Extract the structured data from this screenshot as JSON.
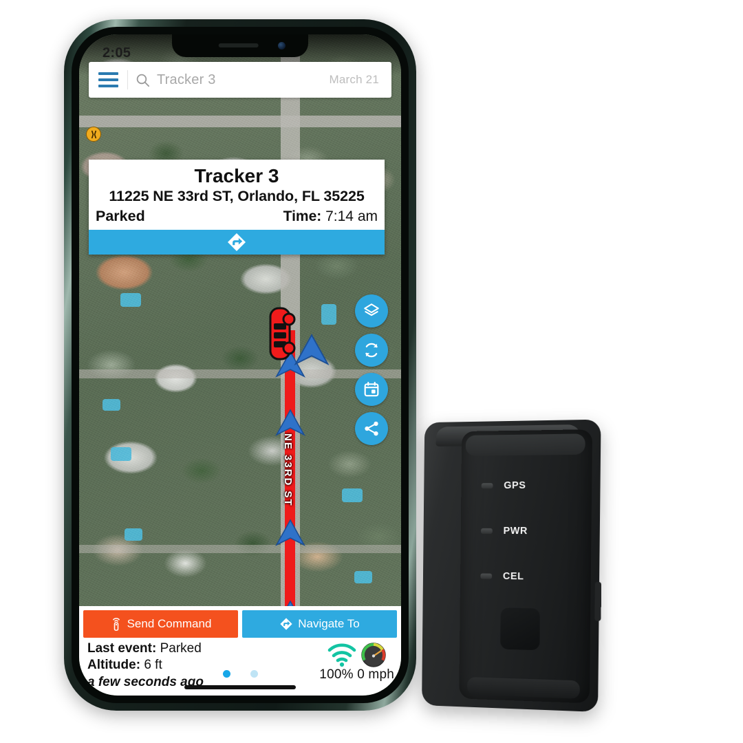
{
  "phone": {
    "status_time": "2:05",
    "searchbar": {
      "menu_icon": "hamburger-icon",
      "search_icon": "search-icon",
      "query_value": "Tracker 3",
      "query_placeholder": "Tracker 3",
      "date_label": "March 21"
    },
    "info_card": {
      "title": "Tracker 3",
      "address": "11225 NE 33rd ST, Orlando, FL 35225",
      "status": "Parked",
      "time_label": "Time:",
      "time_value": "7:14 am",
      "action_icon": "navigate-diamond-icon"
    },
    "map": {
      "street_label": "NE 33RD ST",
      "vehicle_icon": "red-car-icon",
      "heading_icon": "blue-heading-arrow-icon",
      "route_color": "#ef1b1b",
      "poi_icon": "poi-marker-icon",
      "fabs": [
        {
          "name": "layers-button",
          "icon": "layers-icon"
        },
        {
          "name": "refresh-button",
          "icon": "refresh-icon"
        },
        {
          "name": "calendar-button",
          "icon": "calendar-icon"
        },
        {
          "name": "share-button",
          "icon": "share-icon"
        }
      ]
    },
    "bottom_panel": {
      "send_command_label": "Send Command",
      "send_command_icon": "remote-signal-icon",
      "send_command_color": "#f4511e",
      "navigate_label": "Navigate To",
      "navigate_icon": "navigate-diamond-icon",
      "navigate_color": "#2eaae0",
      "last_event_label": "Last event:",
      "last_event_value": "Parked",
      "altitude_label": "Altitude:",
      "altitude_value": "6 ft",
      "relative_time": "a few seconds ago",
      "signal_icon": "wifi-signal-icon",
      "signal_value": "100%",
      "speed_icon": "speedometer-icon",
      "speed_value": "0 mph",
      "pagination": {
        "total": 2,
        "active_index": 0
      }
    }
  },
  "device": {
    "leds": [
      {
        "label": "GPS"
      },
      {
        "label": "PWR"
      },
      {
        "label": "CEL"
      }
    ]
  },
  "colors": {
    "accent_blue": "#2eaae0",
    "accent_orange": "#f4511e",
    "route_red": "#ef1b1b",
    "heading_blue": "#2f72c9",
    "signal_teal": "#13c4a3"
  }
}
